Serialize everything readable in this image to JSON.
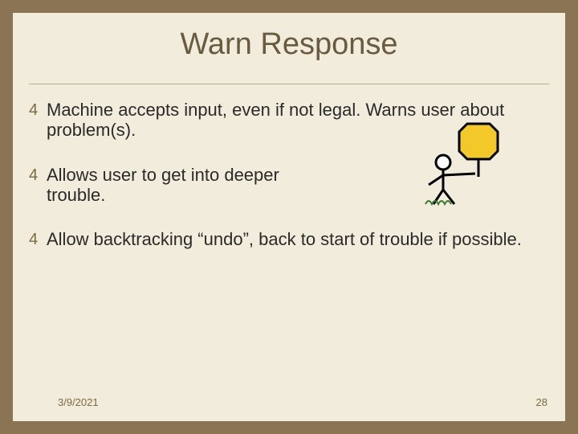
{
  "title": "Warn Response",
  "bullets": [
    {
      "num": "4",
      "text": "Machine accepts input, even if not legal. Warns user about problem(s)."
    },
    {
      "num": "4",
      "text": "Allows user to get into deeper trouble."
    },
    {
      "num": "4",
      "text": "Allow backtracking “undo”, back to start of trouble if possible."
    }
  ],
  "footer": {
    "date": "3/9/2021",
    "page": "28"
  },
  "icon_name": "stop-sign-figure-icon"
}
